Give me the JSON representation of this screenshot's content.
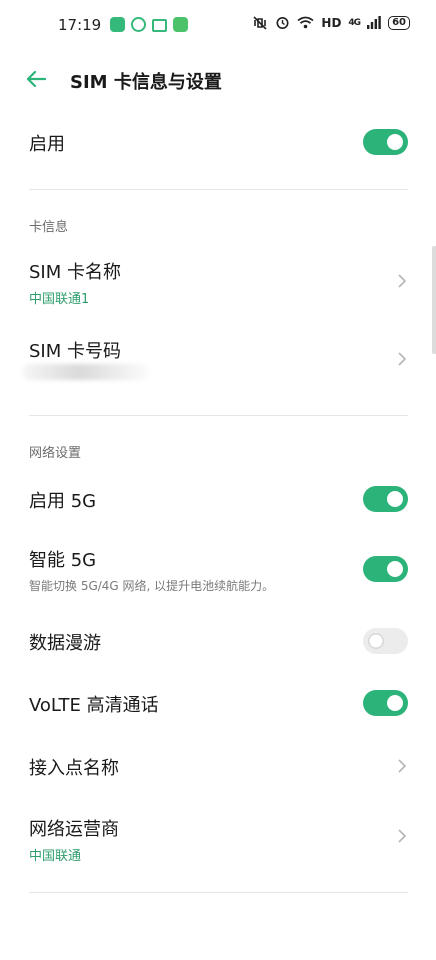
{
  "status_bar": {
    "time": "17:19",
    "network_label": "HD",
    "signal_label": "4G",
    "battery": "60"
  },
  "header": {
    "title": "SIM 卡信息与设置"
  },
  "enable": {
    "label": "启用",
    "on": true
  },
  "card_info": {
    "section_title": "卡信息",
    "sim_name_label": "SIM 卡名称",
    "sim_name_value": "中国联通1",
    "sim_number_label": "SIM 卡号码"
  },
  "network": {
    "section_title": "网络设置",
    "enable_5g": {
      "label": "启用 5G",
      "on": true
    },
    "smart_5g": {
      "label": "智能 5G",
      "description": "智能切换 5G/4G 网络, 以提升电池续航能力。",
      "on": true
    },
    "roaming": {
      "label": "数据漫游",
      "on": false
    },
    "volte": {
      "label": "VoLTE 高清通话",
      "on": true
    },
    "apn": {
      "label": "接入点名称"
    },
    "operator": {
      "label": "网络运营商",
      "value": "中国联通"
    }
  },
  "colors": {
    "accent": "#2bb37a",
    "toggle_off": "#ececec"
  }
}
